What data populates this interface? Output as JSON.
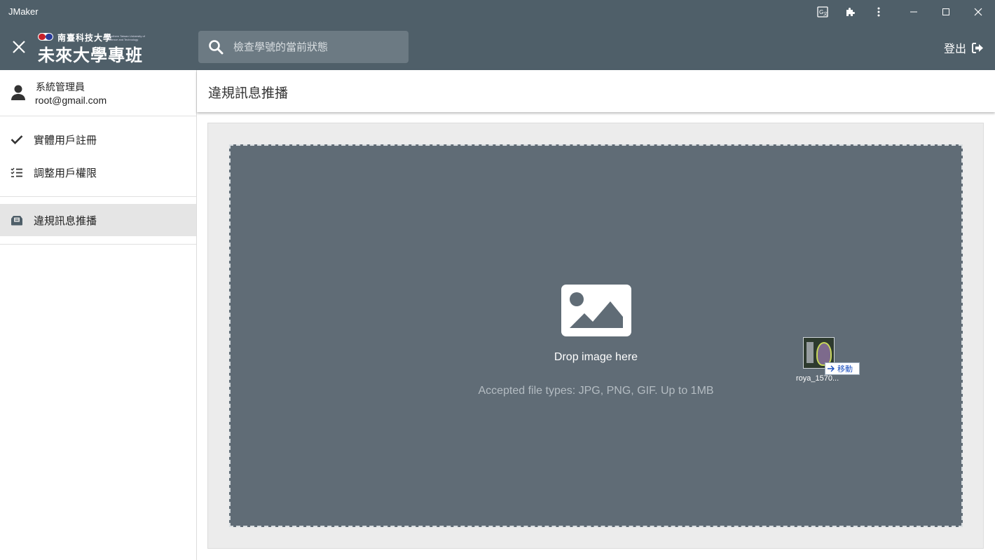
{
  "window": {
    "title": "JMaker",
    "icons": [
      "translate-icon",
      "extension-icon",
      "more-vert-icon"
    ],
    "controls": [
      "minimize",
      "maximize",
      "close"
    ]
  },
  "appbar": {
    "logo_small": "南臺科技大學",
    "logo_en_line1": "Southern Taiwan University of",
    "logo_en_line2": "Science and Technology",
    "logo_big": "未來大學專班",
    "search_placeholder": "檢查學號的當前狀態",
    "search_value": "",
    "logout_label": "登出"
  },
  "sidebar": {
    "user": {
      "name": "系統管理員",
      "email": "root@gmail.com"
    },
    "items": [
      {
        "label": "實體用戶註冊",
        "icon": "check-icon",
        "active": false
      },
      {
        "label": "調整用戶權限",
        "icon": "checklist-icon",
        "active": false
      },
      {
        "label": "違規訊息推播",
        "icon": "inbox-icon",
        "active": true
      }
    ]
  },
  "main": {
    "title": "違規訊息推播",
    "dropzone": {
      "title": "Drop image here",
      "subtitle": "Accepted file types: JPG, PNG, GIF. Up to 1MB"
    }
  },
  "drag": {
    "action_label": "移動",
    "file_name": "roya_1570..."
  },
  "colors": {
    "header_bg": "#4f5f69",
    "search_bg": "#6c7a83",
    "dropzone_bg": "#606c76",
    "active_item_bg": "#e5e5e5"
  }
}
